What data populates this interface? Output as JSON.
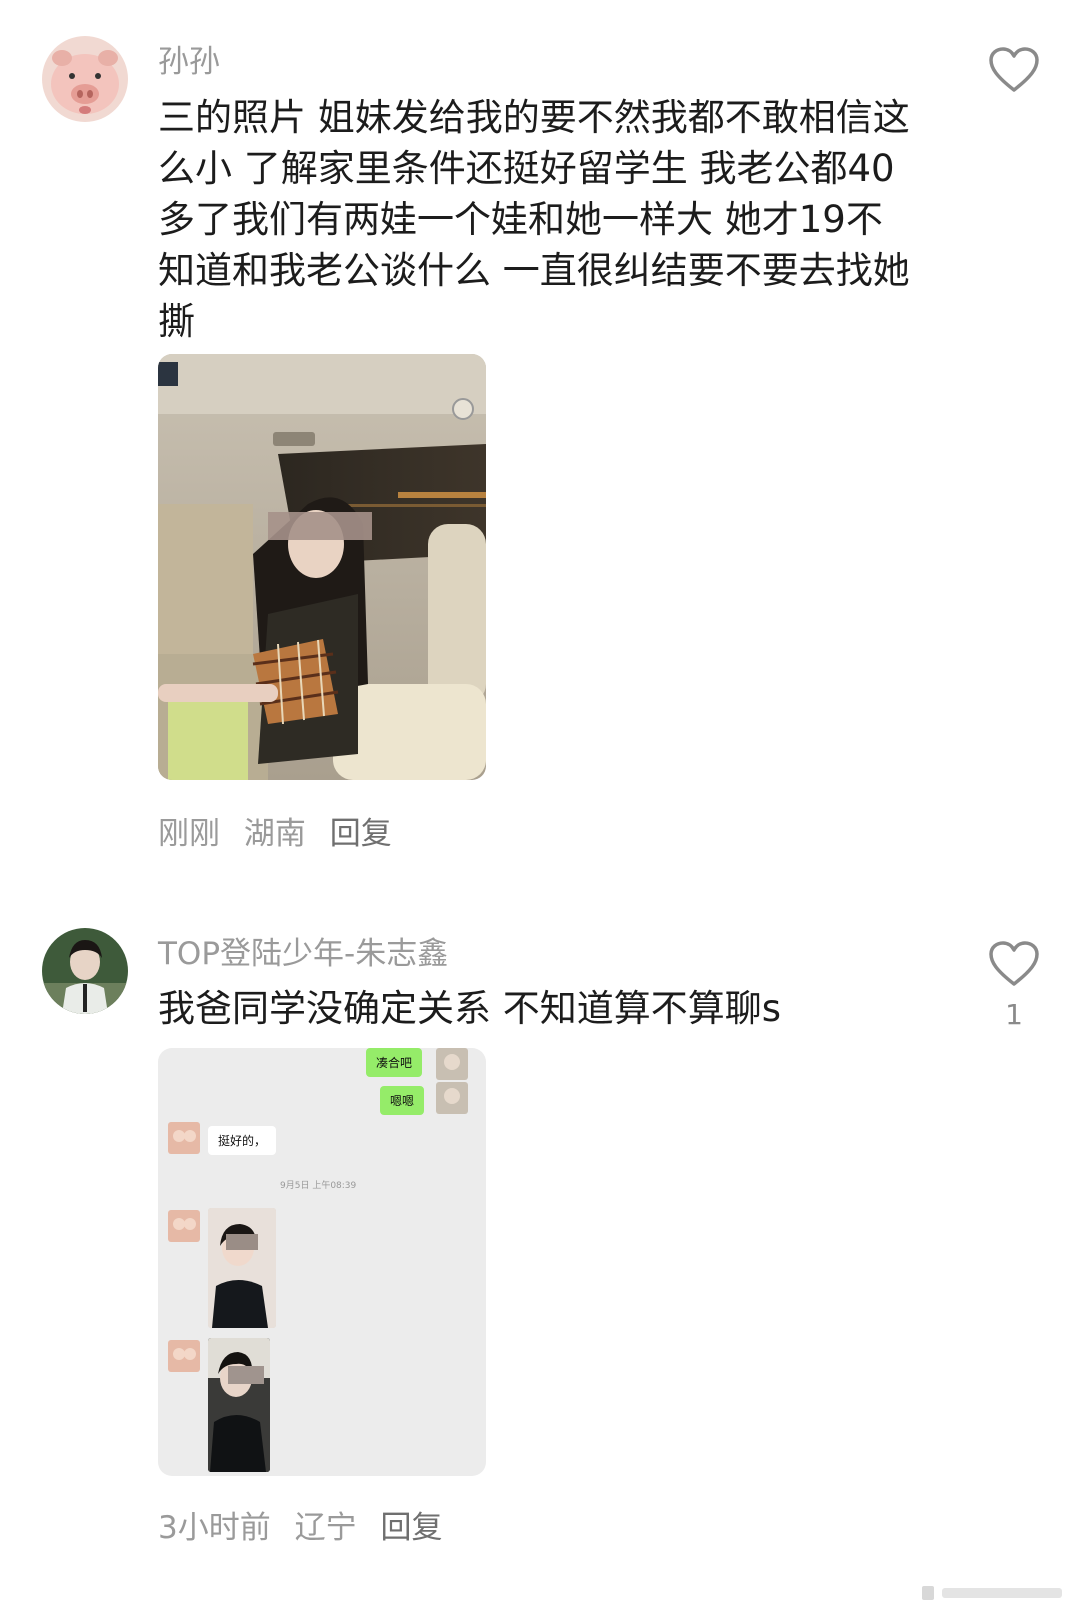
{
  "comments": [
    {
      "username": "孙孙",
      "text": "三的照片 姐妹发给我的要不然我都不敢相信这么小 了解家里条件还挺好留学生 我老公都40多了我们有两娃一个娃和她一样大 她才19不知道和我老公谈什么 一直很纠结要不要去找她撕",
      "time": "刚刚",
      "location": "湖南",
      "reply_label": "回复",
      "likes": "",
      "icons": {
        "avatar": "pig-avatar",
        "like": "heart-icon"
      }
    },
    {
      "username": "TOP登陆少年-朱志鑫",
      "text": "我爸同学没确定关系 不知道算不算聊s",
      "time": "3小时前",
      "location": "辽宁",
      "reply_label": "回复",
      "likes": "1",
      "icons": {
        "avatar": "person-avatar",
        "like": "heart-icon"
      },
      "chat_screenshot": {
        "messages": [
          {
            "side": "right",
            "text": "凑合吧"
          },
          {
            "side": "right",
            "text": "嗯嗯"
          },
          {
            "side": "left",
            "text": "挺好的，"
          }
        ],
        "timestamp": "9月5日 上午08:39"
      }
    }
  ],
  "colors": {
    "username": "#9a9a9a",
    "meta": "#9a9a9a",
    "wechat_green": "#95ec69"
  }
}
